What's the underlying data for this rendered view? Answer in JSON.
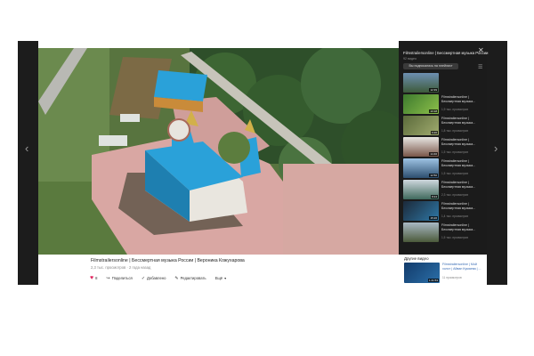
{
  "video": {
    "title": "Filmstrailersonline | Бессмертная музыка России | Вероника Кожухарова",
    "meta": "2,3 тыс. просмотров · 2 года назад",
    "actions": {
      "likes": "8",
      "share": "Поделиться",
      "added": "Добавлено",
      "edit": "Редактировать",
      "more": "Ещё"
    }
  },
  "playlist": {
    "title": "Filmstrailersonline | Бессмертная музыка России",
    "count": "92 видео",
    "subscribed_label": "Вы подписались на плейлист",
    "items": [
      {
        "title": "",
        "views": "",
        "duration": "12:39"
      },
      {
        "title": "Filmstrailersonline | Бессмертная музыка...",
        "views": "1,9 тыс. просмотров",
        "duration": "13:18"
      },
      {
        "title": "Filmstrailersonline | Бессмертная музыка...",
        "views": "1,8 тыс. просмотров",
        "duration": "6:20"
      },
      {
        "title": "Filmstrailersonline | Бессмертная музыка...",
        "views": "1,5 тыс. просмотров",
        "duration": "14:46"
      },
      {
        "title": "Filmstrailersonline | Бессмертная музыка...",
        "views": "1,5 тыс. просмотров",
        "duration": "12:50"
      },
      {
        "title": "Filmstrailersonline | Бессмертная музыка...",
        "views": "2,3 тыс. просмотров",
        "duration": "8:24"
      },
      {
        "title": "Filmstrailersonline | Бессмертная музыка...",
        "views": "1,4 тыс. просмотров",
        "duration": "15:26"
      },
      {
        "title": "Filmstrailersonline | Бессмертная музыка...",
        "views": "1,5 тыс. просмотров",
        "duration": ""
      }
    ]
  },
  "other": {
    "title": "Другие видео",
    "item": {
      "title": "Filmstrailersonline | Мой холст | Айван Кумаева | ...",
      "views": "11 просмотров",
      "duration": "1:41:53"
    }
  },
  "colors": {
    "accent": "#3a6db5",
    "like": "#e0245e",
    "roof": "#2aa1d9",
    "sidebar_bg": "#1b1b1b"
  }
}
